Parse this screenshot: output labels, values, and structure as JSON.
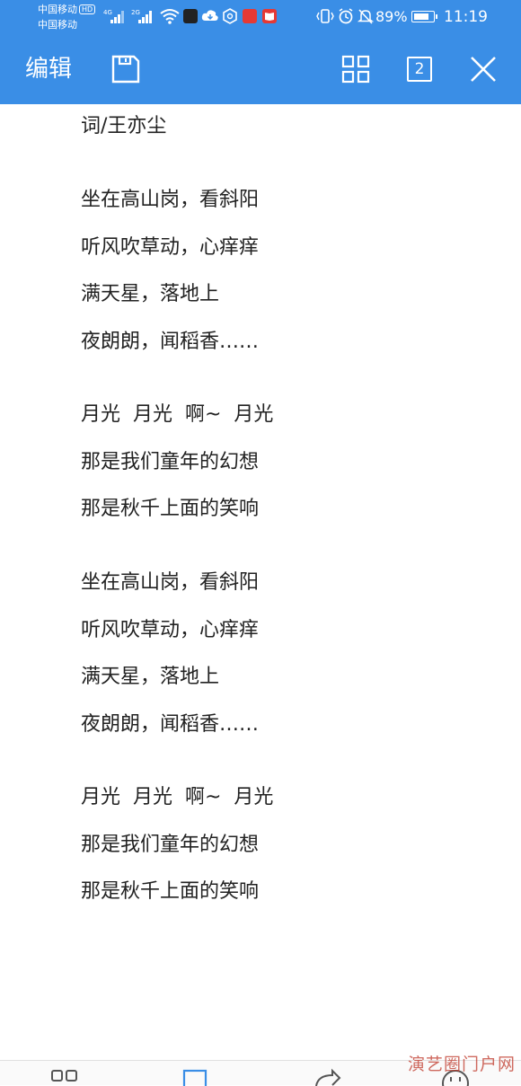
{
  "status_bar": {
    "carrier_1": "中国移动",
    "carrier_1_badge": "HD",
    "carrier_2": "中国移动",
    "net_1": "4G",
    "net_2": "2G",
    "battery_percent": "89%",
    "battery_level": 0.89,
    "time": "11:19",
    "icons": [
      "signal-icon",
      "signal-icon",
      "wifi-icon",
      "app-icon",
      "cloud-icon",
      "settings-icon",
      "app-icon",
      "book-icon",
      "vibrate-icon",
      "alarm-icon",
      "mute-icon",
      "battery-icon"
    ]
  },
  "toolbar": {
    "title": "编辑",
    "tab_count": "2",
    "icons": [
      "save-icon",
      "grid-icon",
      "tabs-icon",
      "close-icon"
    ],
    "background": "#3a8ee6"
  },
  "document": {
    "lines": [
      "词/王亦尘",
      "坐在高山岗，看斜阳",
      "听风吹草动，心痒痒",
      "满天星，落地上",
      "夜朗朗，闻稻香……",
      "月光  月光  啊~  月光",
      "那是我们童年的幻想",
      "那是秋千上面的笑响",
      "坐在高山岗，看斜阳",
      "听风吹草动，心痒痒",
      "满天星，落地上",
      "夜朗朗，闻稻香……",
      "月光  月光  啊~  月光",
      "那是我们童年的幻想",
      "那是秋千上面的笑响"
    ]
  },
  "bottom_bar": {
    "icons": [
      "tool-icon",
      "fullscreen-icon",
      "share-icon",
      "smile-icon"
    ]
  },
  "watermark": "演艺圈门户网"
}
